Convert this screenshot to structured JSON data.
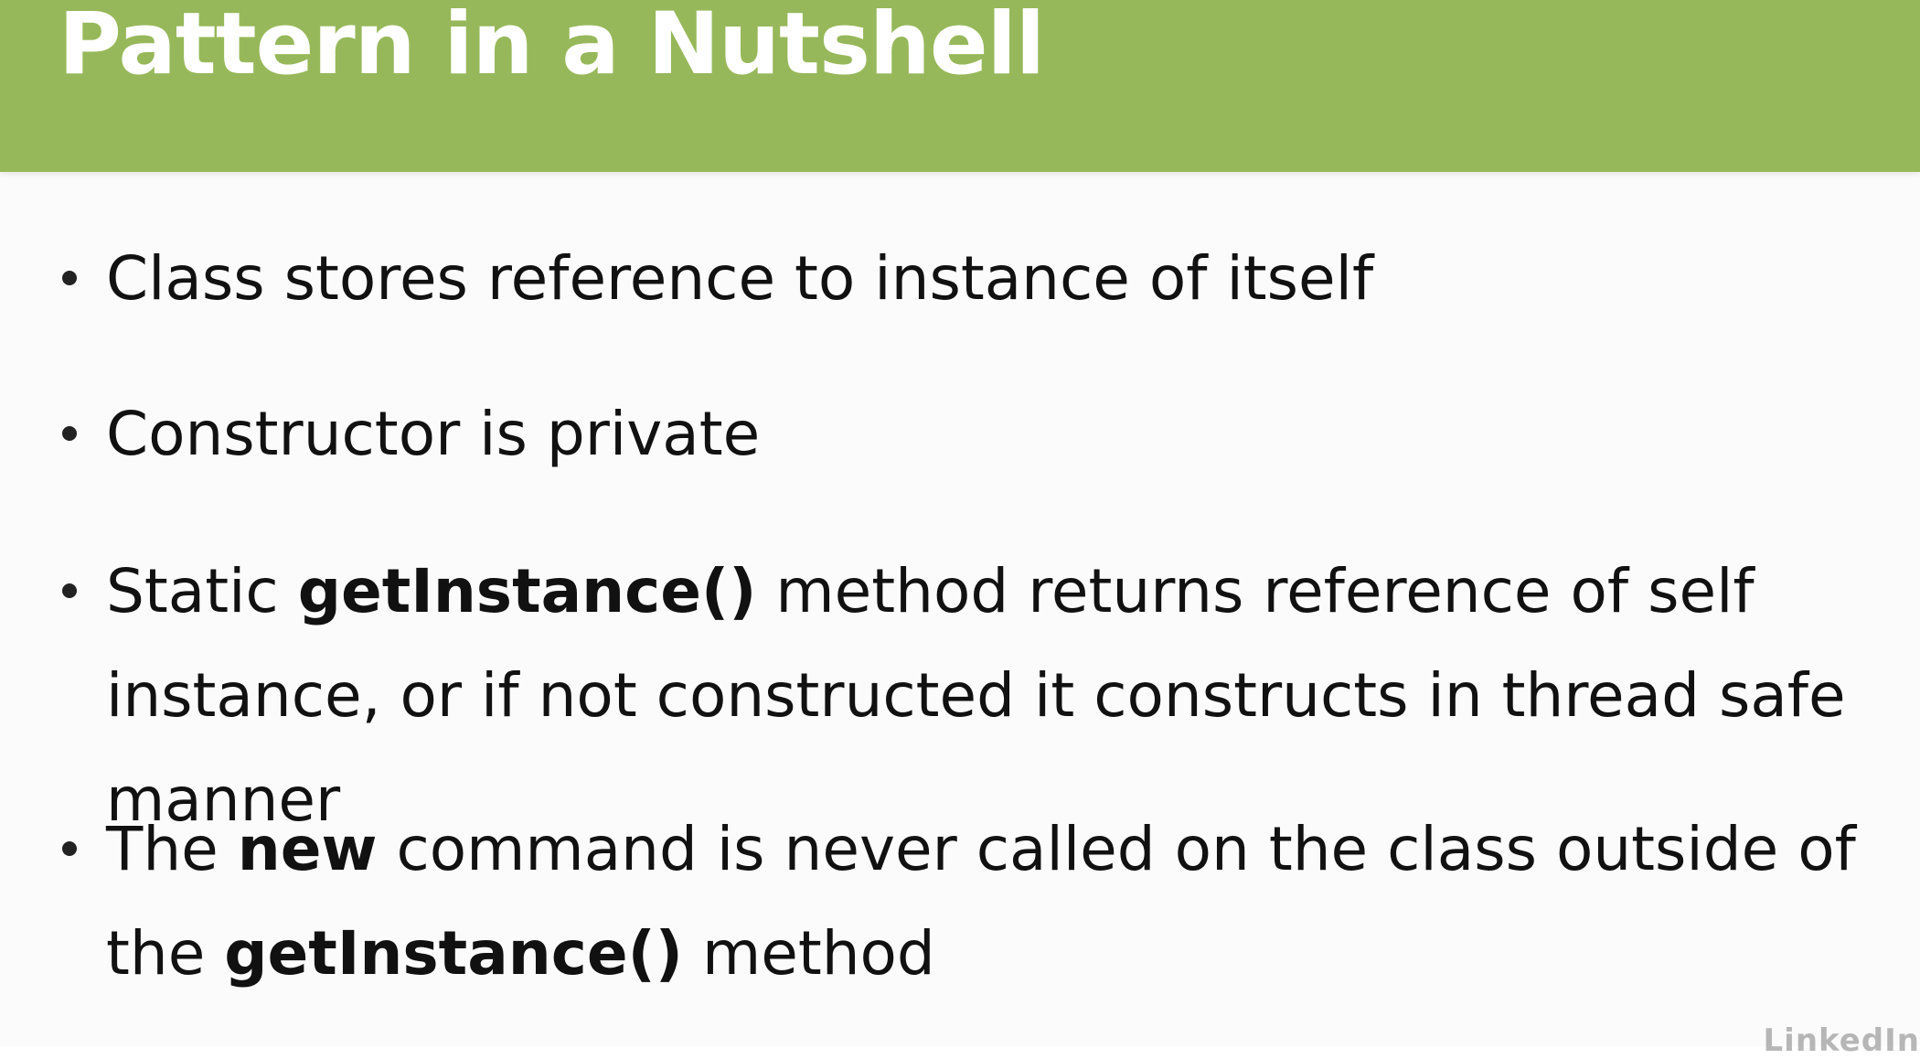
{
  "slide": {
    "title": "Pattern in a Nutshell",
    "bullets": [
      {
        "parts": [
          "Class stores reference to instance of itself"
        ]
      },
      {
        "parts": [
          "Constructor is private"
        ]
      },
      {
        "parts": [
          "Static ",
          "getInstance()",
          " method returns reference of self instance, or if not constructed it constructs in thread safe manner"
        ]
      },
      {
        "parts": [
          "The ",
          "new",
          " command is never called on the class outside of the ",
          "getInstance()",
          " method"
        ]
      }
    ],
    "watermark": "LinkedIn"
  },
  "colors": {
    "header_background": "#97b85a",
    "title_text": "#ffffff",
    "body_text": "#111111"
  }
}
